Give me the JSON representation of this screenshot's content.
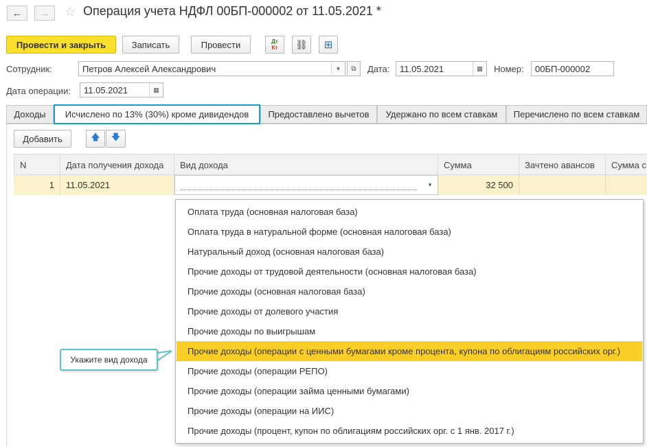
{
  "window": {
    "back_glyph": "←",
    "forward_glyph": "→",
    "star_glyph": "☆",
    "title": "Операция учета НДФЛ 00БП-000002 от 11.05.2021 *"
  },
  "toolbar": {
    "post_close_label": "Провести и закрыть",
    "save_label": "Записать",
    "post_label": "Провести",
    "dtkt_top": "Дт",
    "dtkt_bottom": "Кт",
    "attach_glyph": "⛓",
    "structure_glyph": "⊞"
  },
  "form": {
    "employee_label": "Сотрудник:",
    "employee_value": "Петров Алексей Александрович",
    "date_label": "Дата:",
    "date_value": "11.05.2021",
    "number_label": "Номер:",
    "number_value": "00БП-000002",
    "op_date_label": "Дата операции:",
    "op_date_value": "11.05.2021",
    "dropdown_glyph": "▾",
    "open_glyph": "⧉",
    "calendar_glyph": "▦"
  },
  "tabs": [
    {
      "label": "Доходы"
    },
    {
      "label": "Исчислено по 13% (30%) кроме дивидендов"
    },
    {
      "label": "Предоставлено вычетов"
    },
    {
      "label": "Удержано по всем ставкам"
    },
    {
      "label": "Перечислено по всем ставкам"
    }
  ],
  "table_toolbar": {
    "add_label": "Добавить",
    "up_glyph": "🡅",
    "down_glyph": "🡇"
  },
  "table": {
    "columns": [
      "N",
      "Дата получения дохода",
      "Вид дохода",
      "Сумма",
      "Зачтено авансов",
      "Сумма с"
    ],
    "rows": [
      {
        "n": "1",
        "date": "11.05.2021",
        "kind": "",
        "sum": "32 500",
        "advance": "",
        "sum2": ""
      }
    ]
  },
  "income_options": [
    "Оплата труда (основная налоговая база)",
    "Оплата труда в натуральной форме (основная налоговая база)",
    "Натуральный доход (основная налоговая база)",
    "Прочие доходы от трудовой деятельности (основная налоговая база)",
    "Прочие доходы (основная налоговая база)",
    "Прочие доходы от долевого участия",
    "Прочие доходы по выигрышам",
    "Прочие доходы (операции с ценными бумагами кроме процента, купона по облигациям российских орг.)",
    "Прочие доходы (операции РЕПО)",
    "Прочие доходы (операции займа ценными бумагами)",
    "Прочие доходы (операции на ИИС)",
    "Прочие доходы (процент, купон по облигациям российских орг. с 1 янв. 2017 г.)"
  ],
  "selected_option_index": 7,
  "callout": {
    "text": "Укажите вид дохода"
  },
  "colors": {
    "primary_button": "#fbe02b",
    "selected_option": "#fbcf27",
    "active_tab_border": "#1d9cc7",
    "row_highlight": "#fbf2cc",
    "callout_border": "#5fc4c9"
  }
}
